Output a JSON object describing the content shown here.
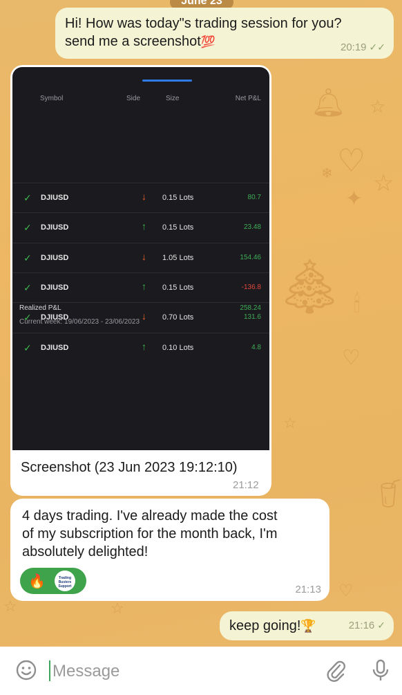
{
  "date_header": "June 23",
  "messages": {
    "m1": {
      "text_line1": "Hi! How was today\"s trading session for you?",
      "text_line2": "send me a screenshot",
      "emoji": "💯",
      "time": "20:19",
      "status": "read"
    },
    "m2": {
      "caption": "Screenshot (23 Jun 2023 19:12:10)",
      "time": "21:12"
    },
    "m3": {
      "line1": "4 days trading. I've already made the cost",
      "line2": "of my subscription for the month back, I'm",
      "line3": "absolutely delighted!",
      "time": "21:13",
      "reaction": {
        "emoji": "🔥",
        "avatar_text_1": "Trading",
        "avatar_text_2": "Busters",
        "avatar_text_3": "Support"
      }
    },
    "m4": {
      "text": "keep going!",
      "emoji": "🏆",
      "time": "21:16",
      "status": "sent"
    }
  },
  "trading_screenshot": {
    "headers": {
      "symbol": "Symbol",
      "side": "Side",
      "size": "Size",
      "pnl": "Net P&L"
    },
    "rows": [
      {
        "symbol": "DJIUSD",
        "side": "sell",
        "size": "0.15 Lots",
        "pnl": "80.7",
        "pnl_positive": true
      },
      {
        "symbol": "DJIUSD",
        "side": "buy",
        "size": "0.15 Lots",
        "pnl": "23.48",
        "pnl_positive": true
      },
      {
        "symbol": "DJIUSD",
        "side": "sell",
        "size": "1.05 Lots",
        "pnl": "154.46",
        "pnl_positive": true
      },
      {
        "symbol": "DJIUSD",
        "side": "buy",
        "size": "0.15 Lots",
        "pnl": "-136.8",
        "pnl_positive": false
      },
      {
        "symbol": "DJIUSD",
        "side": "sell",
        "size": "0.70 Lots",
        "pnl": "131.6",
        "pnl_positive": true
      },
      {
        "symbol": "DJIUSD",
        "side": "buy",
        "size": "0.10 Lots",
        "pnl": "4.8",
        "pnl_positive": true
      }
    ],
    "realized_label": "Realized P&L",
    "realized_value": "258.24",
    "week_label": "Current week: 19/06/2023 - 23/06/2023",
    "colors": {
      "buy": "#3fb950",
      "sell": "#f0642a",
      "positive": "#3fae57",
      "negative": "#e5483c"
    }
  },
  "composer": {
    "placeholder": "Message",
    "emoji_icon": "smiley-icon",
    "attach_icon": "paperclip-icon",
    "mic_icon": "microphone-icon"
  }
}
